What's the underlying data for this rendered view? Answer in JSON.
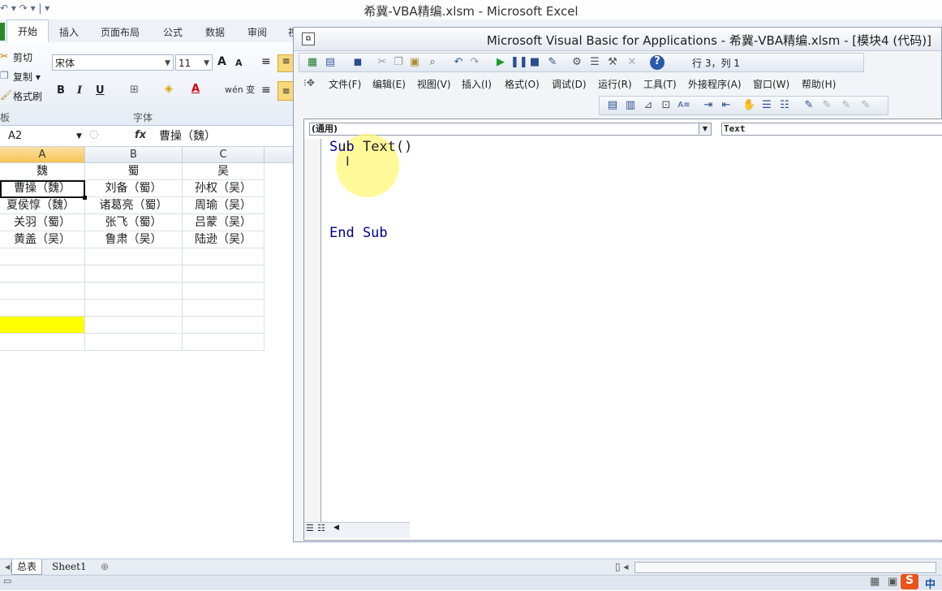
{
  "excel": {
    "window_title": "希冀-VBA精编.xlsm - Microsoft Excel",
    "qat": "↶ ▾ ↷ ▾ | ▾",
    "tabs": [
      "开始",
      "插入",
      "页面布局",
      "公式",
      "数据",
      "审阅",
      "视"
    ],
    "clipboard": {
      "cut": "剪切",
      "copy": "复制 ▾",
      "painter": "格式刷",
      "group_label": "板"
    },
    "font": {
      "name": "宋体",
      "size": "11",
      "grow": "A",
      "shrink": "A",
      "bold": "B",
      "italic": "I",
      "underline": "U",
      "group_label": "字体",
      "phonetic": "wén 变"
    },
    "name_box": "A2",
    "fx": "fx",
    "formula": "曹操（魏）",
    "columns": [
      "A",
      "B",
      "C"
    ],
    "rows": [
      [
        "魏",
        "蜀",
        "吴"
      ],
      [
        "曹操（魏）",
        "刘备（蜀）",
        "孙权（吴）"
      ],
      [
        "夏侯惇（魏）",
        "诸葛亮（蜀）",
        "周瑜（吴）"
      ],
      [
        "关羽（蜀）",
        "张飞（蜀）",
        "吕蒙（吴）"
      ],
      [
        "黄盖（吴）",
        "鲁肃（吴）",
        "陆逊（吴）"
      ]
    ],
    "sheet_tabs": [
      "总表",
      "Sheet1"
    ],
    "ime_label": "中",
    "colors": {
      "selected_cell_fill": "#ffff00",
      "accent": "#f6c453"
    }
  },
  "vbe": {
    "window_title": "Microsoft Visual Basic for Applications - 希冀-VBA精编.xlsm - [模块4 (代码)]",
    "position": "行 3，列 1",
    "menus": [
      "文件(F)",
      "编辑(E)",
      "视图(V)",
      "插入(I)",
      "格式(O)",
      "调试(D)",
      "运行(R)",
      "工具(T)",
      "外接程序(A)",
      "窗口(W)",
      "帮助(H)"
    ],
    "object_combo": "(通用)",
    "procedure_combo": "Text",
    "code": {
      "line1_kw": "Sub",
      "line1_name": " Text()",
      "line_end": "End Sub"
    }
  }
}
